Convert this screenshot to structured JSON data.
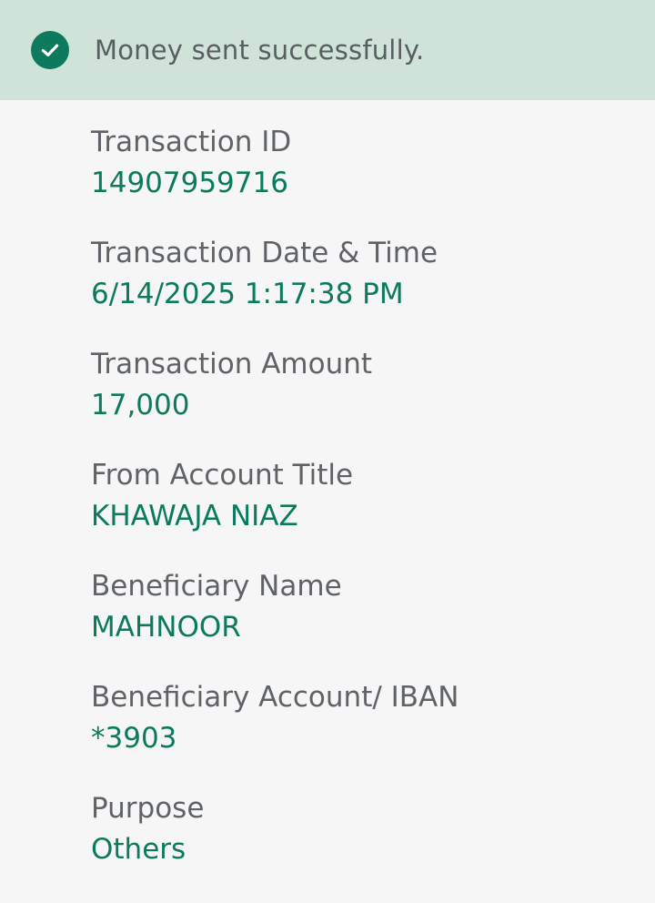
{
  "banner": {
    "message": "Money sent successfully.",
    "icon": "check-circle-icon",
    "bg_color": "#cfe3d9",
    "accent_color": "#0c7a5d"
  },
  "details": [
    {
      "key": "transaction-id",
      "label": "Transaction ID",
      "value": "14907959716"
    },
    {
      "key": "transaction-date-time",
      "label": "Transaction Date & Time",
      "value": "6/14/2025 1:17:38 PM"
    },
    {
      "key": "transaction-amount",
      "label": "Transaction Amount",
      "value": "17,000"
    },
    {
      "key": "from-account-title",
      "label": "From Account Title",
      "value": "KHAWAJA NIAZ"
    },
    {
      "key": "beneficiary-name",
      "label": "Beneficiary Name",
      "value": "MAHNOOR"
    },
    {
      "key": "beneficiary-account",
      "label": "Beneficiary Account/ IBAN",
      "value": "*3903"
    },
    {
      "key": "purpose",
      "label": "Purpose",
      "value": "Others"
    }
  ]
}
